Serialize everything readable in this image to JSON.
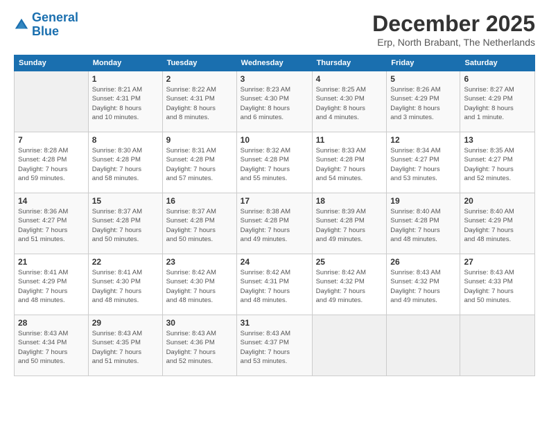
{
  "logo": {
    "line1": "General",
    "line2": "Blue"
  },
  "title": "December 2025",
  "subtitle": "Erp, North Brabant, The Netherlands",
  "header_days": [
    "Sunday",
    "Monday",
    "Tuesday",
    "Wednesday",
    "Thursday",
    "Friday",
    "Saturday"
  ],
  "weeks": [
    [
      {
        "day": "",
        "info": ""
      },
      {
        "day": "1",
        "info": "Sunrise: 8:21 AM\nSunset: 4:31 PM\nDaylight: 8 hours\nand 10 minutes."
      },
      {
        "day": "2",
        "info": "Sunrise: 8:22 AM\nSunset: 4:31 PM\nDaylight: 8 hours\nand 8 minutes."
      },
      {
        "day": "3",
        "info": "Sunrise: 8:23 AM\nSunset: 4:30 PM\nDaylight: 8 hours\nand 6 minutes."
      },
      {
        "day": "4",
        "info": "Sunrise: 8:25 AM\nSunset: 4:30 PM\nDaylight: 8 hours\nand 4 minutes."
      },
      {
        "day": "5",
        "info": "Sunrise: 8:26 AM\nSunset: 4:29 PM\nDaylight: 8 hours\nand 3 minutes."
      },
      {
        "day": "6",
        "info": "Sunrise: 8:27 AM\nSunset: 4:29 PM\nDaylight: 8 hours\nand 1 minute."
      }
    ],
    [
      {
        "day": "7",
        "info": "Sunrise: 8:28 AM\nSunset: 4:28 PM\nDaylight: 7 hours\nand 59 minutes."
      },
      {
        "day": "8",
        "info": "Sunrise: 8:30 AM\nSunset: 4:28 PM\nDaylight: 7 hours\nand 58 minutes."
      },
      {
        "day": "9",
        "info": "Sunrise: 8:31 AM\nSunset: 4:28 PM\nDaylight: 7 hours\nand 57 minutes."
      },
      {
        "day": "10",
        "info": "Sunrise: 8:32 AM\nSunset: 4:28 PM\nDaylight: 7 hours\nand 55 minutes."
      },
      {
        "day": "11",
        "info": "Sunrise: 8:33 AM\nSunset: 4:28 PM\nDaylight: 7 hours\nand 54 minutes."
      },
      {
        "day": "12",
        "info": "Sunrise: 8:34 AM\nSunset: 4:27 PM\nDaylight: 7 hours\nand 53 minutes."
      },
      {
        "day": "13",
        "info": "Sunrise: 8:35 AM\nSunset: 4:27 PM\nDaylight: 7 hours\nand 52 minutes."
      }
    ],
    [
      {
        "day": "14",
        "info": "Sunrise: 8:36 AM\nSunset: 4:27 PM\nDaylight: 7 hours\nand 51 minutes."
      },
      {
        "day": "15",
        "info": "Sunrise: 8:37 AM\nSunset: 4:28 PM\nDaylight: 7 hours\nand 50 minutes."
      },
      {
        "day": "16",
        "info": "Sunrise: 8:37 AM\nSunset: 4:28 PM\nDaylight: 7 hours\nand 50 minutes."
      },
      {
        "day": "17",
        "info": "Sunrise: 8:38 AM\nSunset: 4:28 PM\nDaylight: 7 hours\nand 49 minutes."
      },
      {
        "day": "18",
        "info": "Sunrise: 8:39 AM\nSunset: 4:28 PM\nDaylight: 7 hours\nand 49 minutes."
      },
      {
        "day": "19",
        "info": "Sunrise: 8:40 AM\nSunset: 4:28 PM\nDaylight: 7 hours\nand 48 minutes."
      },
      {
        "day": "20",
        "info": "Sunrise: 8:40 AM\nSunset: 4:29 PM\nDaylight: 7 hours\nand 48 minutes."
      }
    ],
    [
      {
        "day": "21",
        "info": "Sunrise: 8:41 AM\nSunset: 4:29 PM\nDaylight: 7 hours\nand 48 minutes."
      },
      {
        "day": "22",
        "info": "Sunrise: 8:41 AM\nSunset: 4:30 PM\nDaylight: 7 hours\nand 48 minutes."
      },
      {
        "day": "23",
        "info": "Sunrise: 8:42 AM\nSunset: 4:30 PM\nDaylight: 7 hours\nand 48 minutes."
      },
      {
        "day": "24",
        "info": "Sunrise: 8:42 AM\nSunset: 4:31 PM\nDaylight: 7 hours\nand 48 minutes."
      },
      {
        "day": "25",
        "info": "Sunrise: 8:42 AM\nSunset: 4:32 PM\nDaylight: 7 hours\nand 49 minutes."
      },
      {
        "day": "26",
        "info": "Sunrise: 8:43 AM\nSunset: 4:32 PM\nDaylight: 7 hours\nand 49 minutes."
      },
      {
        "day": "27",
        "info": "Sunrise: 8:43 AM\nSunset: 4:33 PM\nDaylight: 7 hours\nand 50 minutes."
      }
    ],
    [
      {
        "day": "28",
        "info": "Sunrise: 8:43 AM\nSunset: 4:34 PM\nDaylight: 7 hours\nand 50 minutes."
      },
      {
        "day": "29",
        "info": "Sunrise: 8:43 AM\nSunset: 4:35 PM\nDaylight: 7 hours\nand 51 minutes."
      },
      {
        "day": "30",
        "info": "Sunrise: 8:43 AM\nSunset: 4:36 PM\nDaylight: 7 hours\nand 52 minutes."
      },
      {
        "day": "31",
        "info": "Sunrise: 8:43 AM\nSunset: 4:37 PM\nDaylight: 7 hours\nand 53 minutes."
      },
      {
        "day": "",
        "info": ""
      },
      {
        "day": "",
        "info": ""
      },
      {
        "day": "",
        "info": ""
      }
    ]
  ]
}
